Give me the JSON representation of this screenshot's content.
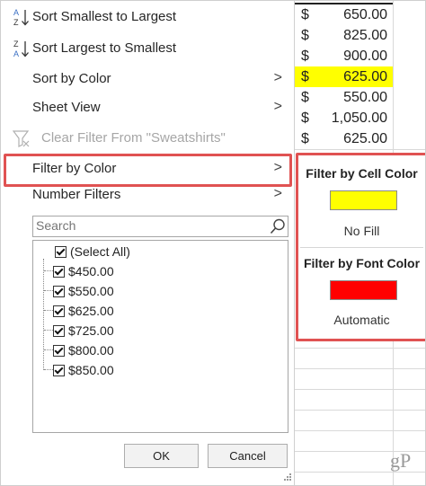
{
  "menu": {
    "sort_asc_label": "Sort Smallest to Largest",
    "sort_desc_label": "Sort Largest to Smallest",
    "sort_by_color_label": "Sort by Color",
    "sheet_view_label": "Sheet View",
    "clear_filter_label": "Clear Filter From \"Sweatshirts\"",
    "filter_by_color_label": "Filter by Color",
    "number_filters_label": "Number Filters",
    "arrow": ">"
  },
  "search": {
    "placeholder": "Search"
  },
  "values_list": {
    "select_all": "(Select All)",
    "items": [
      "$450.00",
      "$550.00",
      "$625.00",
      "$725.00",
      "$800.00",
      "$850.00"
    ]
  },
  "buttons": {
    "ok": "OK",
    "cancel": "Cancel"
  },
  "submenu": {
    "cell_color_title": "Filter by Cell Color",
    "no_fill_label": "No Fill",
    "font_color_title": "Filter by Font Color",
    "automatic_label": "Automatic"
  },
  "sheet": {
    "currency_symbol": "$",
    "rows": [
      {
        "value": "650.00"
      },
      {
        "value": "825.00"
      },
      {
        "value": "900.00"
      },
      {
        "value": "625.00",
        "fill": "#ffff00"
      },
      {
        "value": "550.00"
      },
      {
        "value": "1,050.00"
      },
      {
        "value": "625.00"
      }
    ]
  },
  "watermark": "gP",
  "colors": {
    "highlight_border": "#e05252",
    "cell_yellow": "#ffff00",
    "font_red": "#ff0000"
  }
}
